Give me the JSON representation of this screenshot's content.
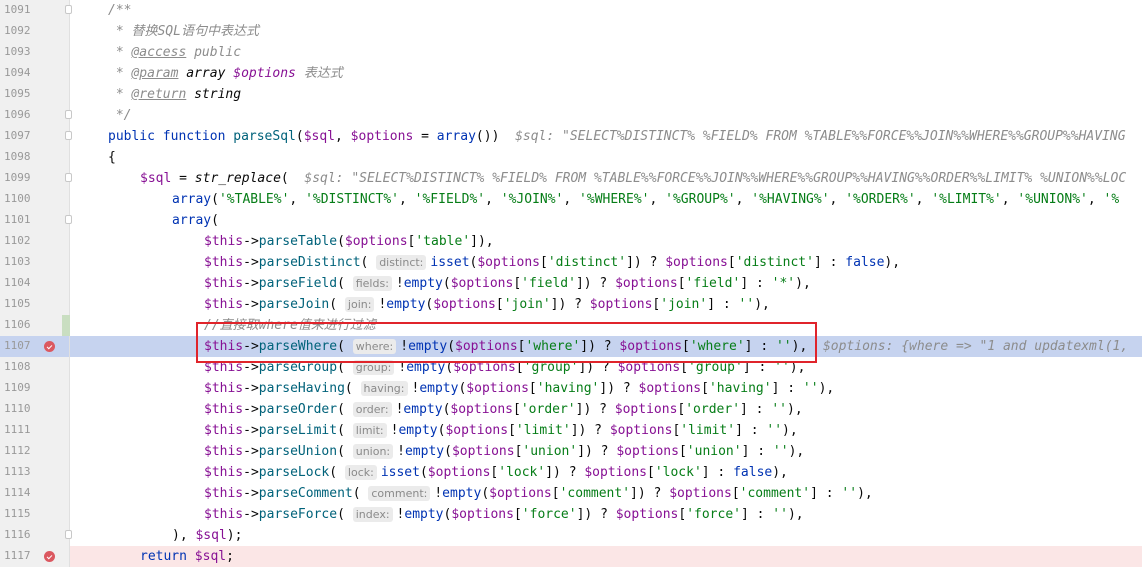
{
  "gutter": {
    "line_numbers": [
      "1091",
      "1092",
      "1093",
      "1094",
      "1095",
      "1096",
      "1097",
      "1098",
      "1099",
      "1100",
      "1101",
      "1102",
      "1103",
      "1104",
      "1105",
      "1106",
      "1107",
      "1108",
      "1109",
      "1110",
      "1111",
      "1112",
      "1113",
      "1114",
      "1115",
      "1116",
      "1117"
    ]
  },
  "doc": {
    "open": "/**",
    "l1": " * 替换SQL语句中表达式",
    "l2_star": " * ",
    "l2_tag": "@access",
    "l2_rest": " public",
    "l3_star": " * ",
    "l3_tag": "@param",
    "l3_type": " array ",
    "l3_var": "$options",
    "l3_desc": " 表达式",
    "l4_star": " * ",
    "l4_tag": "@return",
    "l4_type": " string",
    "close": " */"
  },
  "sig": {
    "kw1": "public",
    "kw2": "function",
    "name": "parseSql",
    "p1": "$sql",
    "p2": "$options",
    "arr": "array",
    "inline": "$sql: \"SELECT%DISTINCT% %FIELD% FROM %TABLE%%FORCE%%JOIN%%WHERE%%GROUP%%HAVING"
  },
  "brace_open": "{",
  "l1099": {
    "var": "$sql",
    "fn": "str_replace",
    "inline": "$sql: \"SELECT%DISTINCT% %FIELD% FROM %TABLE%%FORCE%%JOIN%%WHERE%%GROUP%%HAVING%%ORDER%%LIMIT% %UNION%%LOC"
  },
  "l1100": {
    "arr": "array",
    "strings": [
      "'%TABLE%'",
      "'%DISTINCT%'",
      "'%FIELD%'",
      "'%JOIN%'",
      "'%WHERE%'",
      "'%GROUP%'",
      "'%HAVING%'",
      "'%ORDER%'",
      "'%LIMIT%'",
      "'%UNION%'",
      "'%"
    ]
  },
  "l1101": {
    "arr": "array"
  },
  "this": "$this",
  "opts": "$options",
  "calls": [
    {
      "fn": "parseTable",
      "hint": "",
      "pre": "",
      "fnc": "",
      "key": "'table'",
      "tail": ""
    },
    {
      "fn": "parseDistinct",
      "hint": "distinct:",
      "pre": "",
      "fnc": "isset",
      "key": "'distinct'",
      "tail": "false"
    },
    {
      "fn": "parseField",
      "hint": "fields:",
      "pre": "!",
      "fnc": "empty",
      "key": "'field'",
      "tail": "'*'"
    },
    {
      "fn": "parseJoin",
      "hint": "join:",
      "pre": "!",
      "fnc": "empty",
      "key": "'join'",
      "tail": "''"
    },
    {
      "fn": "parseWhere",
      "hint": "where:",
      "pre": "!",
      "fnc": "empty",
      "key": "'where'",
      "tail": "''"
    },
    {
      "fn": "parseGroup",
      "hint": "group:",
      "pre": "!",
      "fnc": "empty",
      "key": "'group'",
      "tail": "''"
    },
    {
      "fn": "parseHaving",
      "hint": "having:",
      "pre": "!",
      "fnc": "empty",
      "key": "'having'",
      "tail": "''"
    },
    {
      "fn": "parseOrder",
      "hint": "order:",
      "pre": "!",
      "fnc": "empty",
      "key": "'order'",
      "tail": "''"
    },
    {
      "fn": "parseLimit",
      "hint": "limit:",
      "pre": "!",
      "fnc": "empty",
      "key": "'limit'",
      "tail": "''"
    },
    {
      "fn": "parseUnion",
      "hint": "union:",
      "pre": "!",
      "fnc": "empty",
      "key": "'union'",
      "tail": "''"
    },
    {
      "fn": "parseLock",
      "hint": "lock:",
      "pre": "",
      "fnc": "isset",
      "key": "'lock'",
      "tail": "false"
    },
    {
      "fn": "parseComment",
      "hint": "comment:",
      "pre": "!",
      "fnc": "empty",
      "key": "'comment'",
      "tail": "''"
    },
    {
      "fn": "parseForce",
      "hint": "index:",
      "pre": "!",
      "fnc": "empty",
      "key": "'force'",
      "tail": "''"
    }
  ],
  "l1106_comment": "//直接取where值来进行过滤",
  "l1107_inline": "$options: {where => \"1 and updatexml(1,",
  "l1116": {
    "close": "), ",
    "var": "$sql",
    "end": ");"
  },
  "l1117": {
    "kw": "return",
    "var": "$sql"
  },
  "colors": {
    "current_line": "#c6d3ef",
    "breakpoint": "#db5860",
    "highlight_box": "#e0242b",
    "keyword": "#0033b3",
    "variable": "#871094",
    "string": "#067d17",
    "function": "#00627a"
  },
  "icons": {
    "breakpoint": "breakpoint-icon",
    "fold": "fold-marker-icon"
  }
}
